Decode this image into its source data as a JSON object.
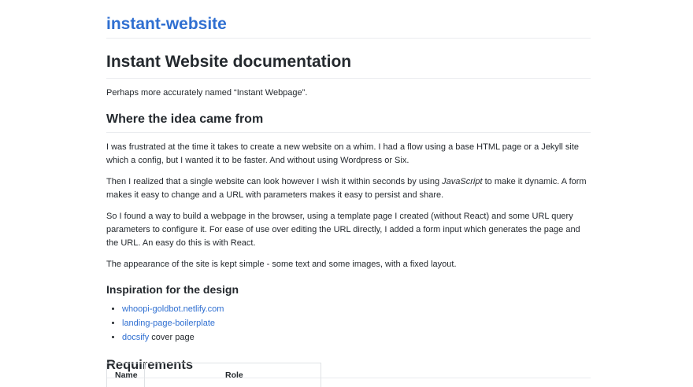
{
  "header": {
    "site_title": "instant-website"
  },
  "doc": {
    "title": "Instant Website documentation",
    "intro": "Perhaps more accurately named “Instant Webpage”.",
    "section_idea": {
      "heading": "Where the idea came from",
      "p1": "I was frustrated at the time it takes to create a new website on a whim. I had a flow using a base HTML page or a Jekyll site which a config, but I wanted it to be faster. And without using Wordpress or Six.",
      "p2_before": "Then I realized that a single website can look however I wish it within seconds by using ",
      "p2_em": "JavaScript",
      "p2_after": " to make it dynamic. A form makes it easy to change and a URL with parameters makes it easy to persist and share.",
      "p3": "So I found a way to build a webpage in the browser, using a template page I created (without React) and some URL query parameters to configure it. For ease of use over editing the URL directly, I added a form input which generates the page and the URL. An easy do this is with React.",
      "p4": "The appearance of the site is kept simple - some text and some images, with a fixed layout."
    },
    "section_inspiration": {
      "heading": "Inspiration for the design",
      "links": [
        {
          "text": "whoopi-goldbot.netlify.com"
        },
        {
          "text": "landing-page-boilerplate"
        },
        {
          "text": "docsify",
          "suffix": " cover page"
        }
      ]
    },
    "section_requirements": {
      "heading": "Requirements",
      "table_headers": [
        "Name",
        "Role"
      ]
    }
  },
  "colors": {
    "link": "#2f6fd1",
    "text": "#24292e",
    "rule": "#eaecef"
  }
}
